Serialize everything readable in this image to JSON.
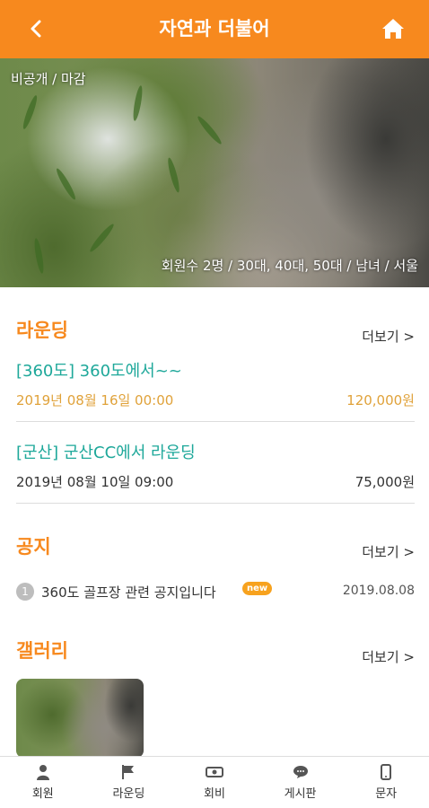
{
  "header": {
    "title": "자연과 더불어",
    "back_icon": "chevron-left-icon",
    "home_icon": "home-icon"
  },
  "club": {
    "status": "비공개 / 마감",
    "info": "회원수 2명 / 30대, 40대, 50대 / 남녀 / 서울"
  },
  "rounding": {
    "title": "라운딩",
    "more": "더보기 >",
    "items": [
      {
        "name": "[360도] 360도에서~~",
        "datetime": "2019년 08월 16일 00:00",
        "price": "120,000원",
        "color": "#e0a23a"
      },
      {
        "name": "[군산] 군산CC에서 라운딩",
        "datetime": "2019년 08월 10일 09:00",
        "price": "75,000원",
        "color": "#333333"
      }
    ]
  },
  "notice": {
    "title": "공지",
    "more": "더보기 >",
    "items": [
      {
        "num": "1",
        "text": "360도 골프장 관련 공지입니다",
        "badge": "new",
        "date": "2019.08.08"
      }
    ]
  },
  "gallery": {
    "title": "갤러리",
    "more": "더보기 >"
  },
  "tabs": [
    {
      "label": "회원",
      "icon": "person-icon"
    },
    {
      "label": "라운딩",
      "icon": "flag-icon"
    },
    {
      "label": "회비",
      "icon": "money-icon"
    },
    {
      "label": "게시판",
      "icon": "chat-icon"
    },
    {
      "label": "문자",
      "icon": "phone-icon"
    }
  ],
  "colors": {
    "brand": "#f7891e",
    "accent_green": "#1ea89a",
    "price_orange": "#e0a23a"
  }
}
